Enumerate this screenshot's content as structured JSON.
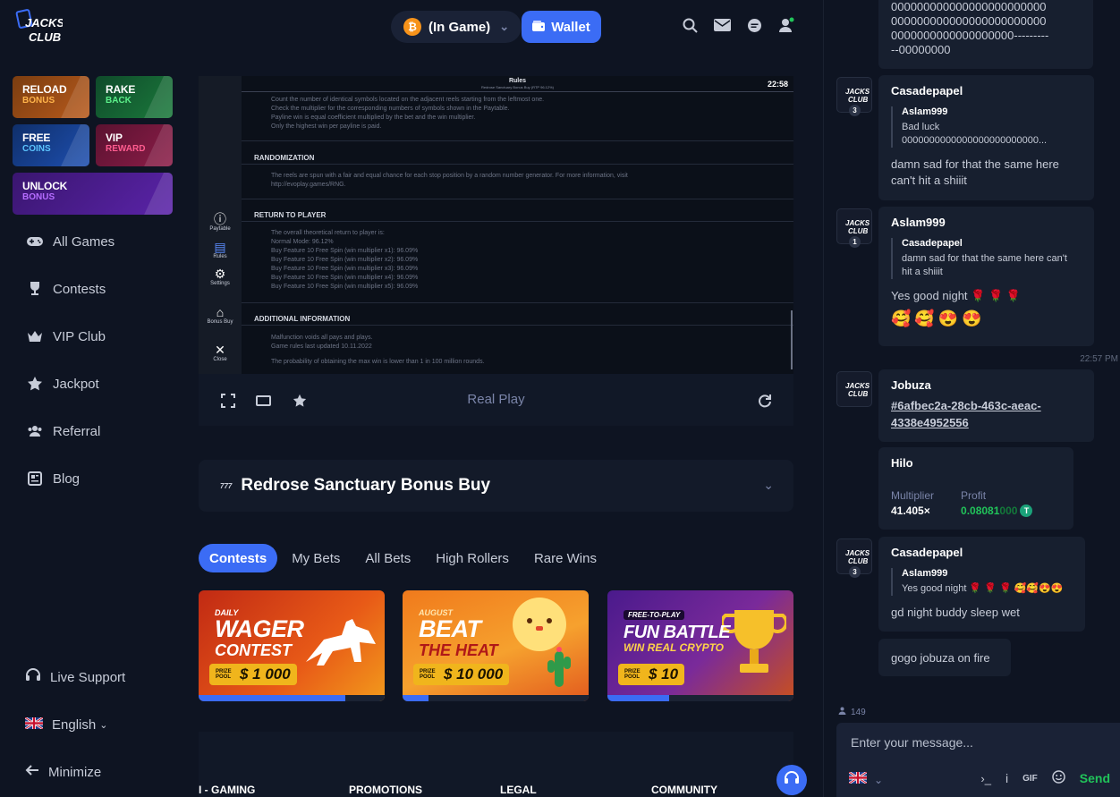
{
  "brand": {
    "logo_line1": "JACKS",
    "logo_line2": "CLUB"
  },
  "promos": {
    "reload": {
      "t1": "RELOAD",
      "t2": "BONUS"
    },
    "rake": {
      "t1": "RAKE",
      "t2": "BACK"
    },
    "free": {
      "t1": "FREE",
      "t2": "COINS"
    },
    "vip": {
      "t1": "VIP",
      "t2": "REWARD"
    },
    "unlock": {
      "t1": "UNLOCK",
      "t2": "BONUS"
    }
  },
  "nav": {
    "all_games": "All Games",
    "contests": "Contests",
    "vip_club": "VIP Club",
    "jackpot": "Jackpot",
    "referral": "Referral",
    "blog": "Blog",
    "live_support": "Live Support",
    "language": "English",
    "minimize": "Minimize"
  },
  "topbar": {
    "currency": "(In Game)",
    "wallet": "Wallet"
  },
  "game_rules": {
    "title": "Rules",
    "subtitle": "Redrose Sanctuary Bonus Buy (RTP 96.12%)",
    "clock": "22:58",
    "intro_lines": [
      "Count the number of identical symbols located on the adjacent reels starting from the leftmost one.",
      "Check the multiplier for the corresponding numbers of symbols shown in the Paytable.",
      "Payline win is equal coefficient multiplied by the bet and the win multiplier.",
      "Only the highest win per payline is paid."
    ],
    "randomization_head": "RANDOMIZATION",
    "randomization_lines": [
      "The reels are spun with a fair and equal chance for each stop position by a random number generator. For more information, visit",
      "http://evoplay.games/RNG."
    ],
    "rtp_head": "RETURN TO PLAYER",
    "rtp_lines": [
      "The overall theoretical return to player is:",
      "Normal Mode: 96.12%",
      "Buy Feature 10 Free Spin (win multiplier x1): 96.09%",
      "Buy Feature 10 Free Spin (win multiplier x2): 96.09%",
      "Buy Feature 10 Free Spin (win multiplier x3): 96.09%",
      "Buy Feature 10 Free Spin (win multiplier x4): 96.09%",
      "Buy Feature 10 Free Spin (win multiplier x5): 96.09%"
    ],
    "additional_head": "ADDITIONAL INFORMATION",
    "additional_lines": [
      "Malfunction voids all pays and plays.",
      "Game rules last updated 10.11.2022",
      "The probability of obtaining the max win is lower than 1 in 100 million rounds."
    ],
    "side": {
      "paytable": "Paytable",
      "rules": "Rules",
      "settings": "Settings",
      "bonus_buy": "Bonus Buy",
      "close": "Close"
    }
  },
  "game_controls": {
    "mode": "Real Play"
  },
  "game_title": {
    "badge": "777",
    "name": "Redrose Sanctuary Bonus Buy"
  },
  "tabs": [
    "Contests",
    "My Bets",
    "All Bets",
    "High Rollers",
    "Rare Wins"
  ],
  "contests": [
    {
      "kicker": "DAILY",
      "big": "WAGER",
      "mid": "CONTEST",
      "prize_label": "PRIZE POOL",
      "prize": "$ 1 000",
      "progress": 0.79
    },
    {
      "kicker": "AUGUST",
      "big": "BEAT",
      "mid": "THE HEAT",
      "prize_label": "PRIZE POOL",
      "prize": "$ 10 000",
      "progress": 0.14
    },
    {
      "kicker": "FREE-TO-PLAY",
      "big": "FUN BATTLE",
      "mid": "WIN REAL CRYPTO",
      "prize_label": "PRIZE POOL",
      "prize": "$ 10",
      "progress": 0.33
    }
  ],
  "footer": {
    "col1": "I - GAMING",
    "col2": "PROMOTIONS",
    "col3": "LEGAL",
    "col4": "COMMUNITY"
  },
  "chat": {
    "top_fragment": [
      "000000000000000000000000",
      "000000000000000000000000",
      "0000000000000000000---------",
      "--00000000"
    ],
    "messages": [
      {
        "user": "Casadepapel",
        "level": "3",
        "quote_user": "Aslam999",
        "quote_lines": [
          "Bad luck",
          "0000000000000000000000000..."
        ],
        "text": "damn sad for that the same here can't hit a shiiit"
      },
      {
        "user": "Aslam999",
        "level": "1",
        "quote_user": "Casadepapel",
        "quote_lines": [
          "damn sad for that the same here can't",
          "hit a shiiit"
        ],
        "text": "Yes good night 🌹 🌹 🌹",
        "emoji": "🥰🥰😍😍"
      },
      {
        "user": "Jobuza",
        "link": "#6afbec2a-28cb-463c-aeac-4338e4952556"
      },
      {
        "user": "Casadepapel",
        "level": "3",
        "quote_user": "Aslam999",
        "quote_lines": [
          "Yes good night 🌹 🌹 🌹 🥰🥰😍😍"
        ],
        "text": "gd night buddy sleep wet"
      }
    ],
    "timestamp": "22:57 PM",
    "bet": {
      "game": "Hilo",
      "multiplier_label": "Multiplier",
      "multiplier": "41.405×",
      "profit_label": "Profit",
      "profit": "0.08081",
      "profit_zeros": "000"
    },
    "followup": "gogo jobuza on fire",
    "online_count": "149",
    "input_placeholder": "Enter your message...",
    "gif": "GIF",
    "send": "Send"
  },
  "colors": {
    "accent": "#3b6cf5",
    "success": "#21c45a",
    "background": "#0e1422"
  }
}
